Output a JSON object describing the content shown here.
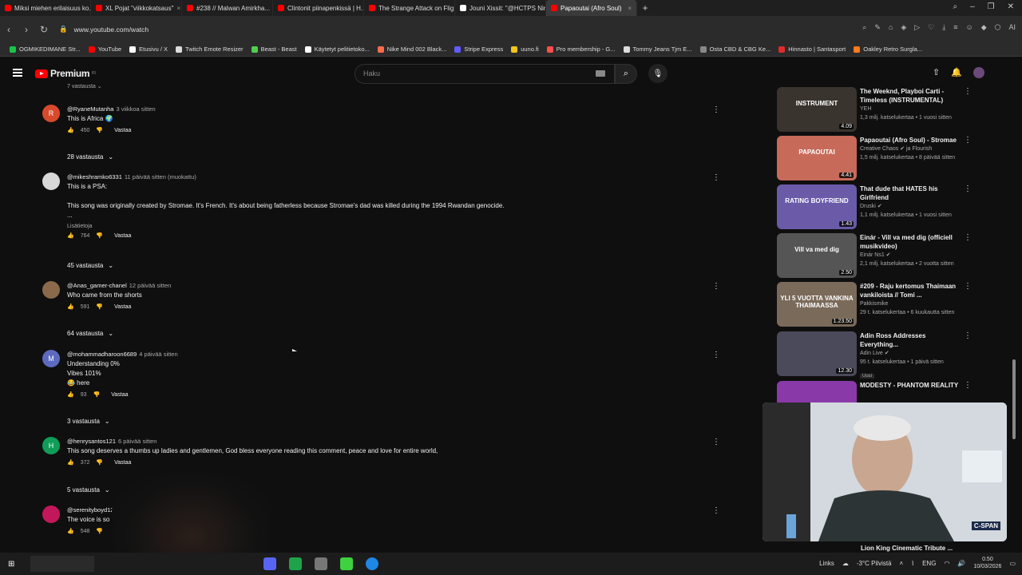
{
  "tabs": [
    {
      "label": "Miksi miehen erilaisuus ko...",
      "color": "#ff0000"
    },
    {
      "label": "XL Pojat \"viikkokatsaus\"",
      "color": "#ff0000"
    },
    {
      "label": "#238 // Malwan Amirkha...",
      "color": "#ff0000"
    },
    {
      "label": "Clintonit piinapenkissä | H...",
      "color": "#ff0000"
    },
    {
      "label": "The Strange Attack on Flig...",
      "color": "#ff0000"
    },
    {
      "label": "Jouni Xissit: \"@HCTPS Nin...",
      "color": "#ffffff"
    },
    {
      "label": "Papaoutai (Afro Soul)",
      "color": "#ff0000",
      "active": true
    }
  ],
  "url": "www.youtube.com/watch",
  "bookmarks": [
    {
      "label": "OGMIKEDIMANE Str...",
      "color": "#19c34a"
    },
    {
      "label": "YouTube",
      "color": "#ff0000"
    },
    {
      "label": "Etusivu / X",
      "color": "#ffffff"
    },
    {
      "label": "Twitch Emote Resizer",
      "color": "#dddddd"
    },
    {
      "label": "Beast - Beast",
      "color": "#4fd04f"
    },
    {
      "label": "Käytetyt pelitietoko...",
      "color": "#ffffff"
    },
    {
      "label": "Nike Mind 002 Black...",
      "color": "#ff6b4a"
    },
    {
      "label": "Stripe Express",
      "color": "#635bff"
    },
    {
      "label": "uuno.fi",
      "color": "#f5c518"
    },
    {
      "label": "Pro membership - G...",
      "color": "#ff4d4d"
    },
    {
      "label": "Tommy Jeans Tjm E...",
      "color": "#dddddd"
    },
    {
      "label": "Osta CBD & CBG Ke...",
      "color": "#888888"
    },
    {
      "label": "Hinnasto | Santasport",
      "color": "#e02b2b"
    },
    {
      "label": "Oakley Retro Surgla...",
      "color": "#ff7a1a"
    }
  ],
  "header": {
    "logo_text": "Premium",
    "logo_sup": "FI",
    "search_placeholder": "Haku"
  },
  "comments": [
    {
      "avatar_letter": "R",
      "avatar_color": "#d84a2c",
      "author": "@RyaneMutanha",
      "time": "3 viikkoa sitten",
      "lines": [
        "This is Africa 🌍"
      ],
      "likes": "450",
      "reply_label": "Vastaa",
      "replies": "28 vastausta"
    },
    {
      "avatar_letter": "",
      "avatar_color": "#d8d8d8",
      "author": "@mikeshramko6331",
      "time": "11 päivää sitten (muokattu)",
      "lines": [
        "This is a PSA:",
        "",
        "This song was originally created by Stromae. It's French. It's about being fatherless because Stromae's dad was killed during the 1994 Rwandan genocide.",
        "..."
      ],
      "more": "Lisätietoja",
      "likes": "764",
      "reply_label": "Vastaa",
      "replies": "45 vastausta"
    },
    {
      "avatar_letter": "",
      "avatar_color": "#8a6a4a",
      "author": "@Anas_gamer-chanel",
      "time": "12 päivää sitten",
      "lines": [
        "Who came from the shorts"
      ],
      "likes": "591",
      "reply_label": "Vastaa",
      "replies": "64 vastausta"
    },
    {
      "avatar_letter": "M",
      "avatar_color": "#5c6bc0",
      "author": "@mohammadharoon6689",
      "time": "4 päivää sitten",
      "lines": [
        "Understanding 0%",
        "Vibes 101%",
        "😂 here"
      ],
      "likes": "93",
      "reply_label": "Vastaa",
      "replies": "3 vastausta"
    },
    {
      "avatar_letter": "H",
      "avatar_color": "#0f9d58",
      "author": "@henrysantos121",
      "time": "6 päivää sitten",
      "lines": [
        "This song deserves a thumbs up ladies and gentlemen, God bless everyone reading this comment, peace and love for entire world,"
      ],
      "likes": "372",
      "reply_label": "Vastaa",
      "replies": "5 vastausta"
    },
    {
      "avatar_letter": "",
      "avatar_color": "#c2185b",
      "author": "@serenityboyd1222",
      "time": "",
      "lines": [
        "The voice is so p... good"
      ],
      "likes": "548",
      "reply_label": "",
      "replies": ""
    }
  ],
  "related": [
    {
      "title": "The Weeknd, Playboi Carti - Timeless (INSTRUMENTAL)",
      "channel": "YEH",
      "meta": "1,3 milj. katselukertaa • 1 vuosi sitten",
      "duration": "4.09",
      "thumb": "#3a342e",
      "thumb_text": "INSTRUMENT"
    },
    {
      "title": "Papaoutai (Afro Soul) - Stromae",
      "channel": "Creative Chaos ✔ ja Flourish",
      "meta": "1,5 milj. katselukertaa • 8 päivää sitten",
      "duration": "4.41",
      "thumb": "#c86a5a",
      "thumb_text": "PAPAOUTAI"
    },
    {
      "title": "That dude that HATES his Girlfriend",
      "channel": "Druski ✔",
      "meta": "1,1 milj. katselukertaa • 1 vuosi sitten",
      "duration": "1.43",
      "thumb": "#6a5aa8",
      "thumb_text": "RATING BOYFRIEND"
    },
    {
      "title": "Einár - Vill va med dig (officiell musikvideo)",
      "channel": "Einár Ns1 ✔",
      "meta": "2,1 milj. katselukertaa • 2 vuotta sitten",
      "duration": "2.50",
      "thumb": "#555555",
      "thumb_text": "Vill va med dig"
    },
    {
      "title": "#209 - Raju kertomus Thaimaan vankiloista // Tomi ...",
      "channel": "Pakkismike",
      "meta": "29 t. katselukertaa • 6 kuukautta sitten",
      "duration": "1.23.50",
      "thumb": "#7a6a5a",
      "thumb_text": "YLI 5 VUOTTA VANKINA THAIMAASSA"
    },
    {
      "title": "Adin Ross Addresses Everything...",
      "channel": "Adin Live ✔",
      "meta": "95 t. katselukertaa • 1 päivä sitten",
      "badge": "Uusi",
      "duration": "12.30",
      "thumb": "#4a4a5a",
      "thumb_text": ""
    },
    {
      "title": "MODESTY - PHANTOM REALITY",
      "channel": "",
      "meta": "",
      "duration": "",
      "thumb": "#8a3aa8",
      "thumb_text": ""
    }
  ],
  "pip": {
    "network": "C-SPAN",
    "caption": "Lion King Cinematic Tribute ..."
  },
  "tray": {
    "links": "Links",
    "weather": "-3°C  Pilvistä",
    "lang": "ENG",
    "time": "0.50",
    "date": "10/03/2026"
  }
}
